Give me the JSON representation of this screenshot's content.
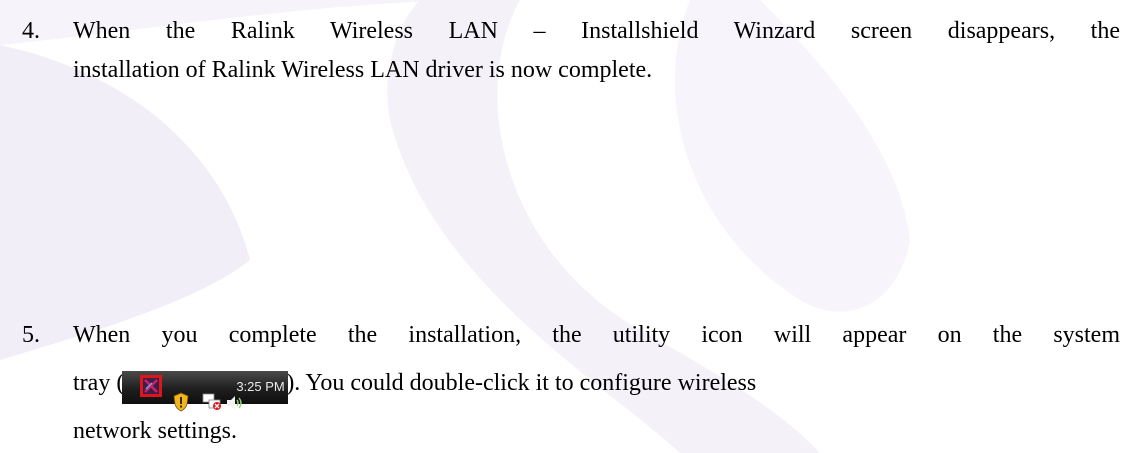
{
  "steps": [
    {
      "number": "4.",
      "line1": "When the Ralink Wireless LAN – Installshield Winzard screen disappears, the",
      "line2": "installation of Ralink Wireless LAN driver is now complete."
    },
    {
      "number": "5.",
      "line1": "When you complete the installation, the utility icon will appear on the system",
      "line2_prefix": "tray (",
      "line2_suffix": "). You could double-click it to configure wireless",
      "line3": "network settings."
    }
  ],
  "tray": {
    "clock": "3:25 PM",
    "icons": [
      "ralink-utility-icon",
      "security-shield-icon",
      "network-disconnected-icon",
      "speaker-volume-icon"
    ],
    "highlight_color": "#e0141b"
  }
}
